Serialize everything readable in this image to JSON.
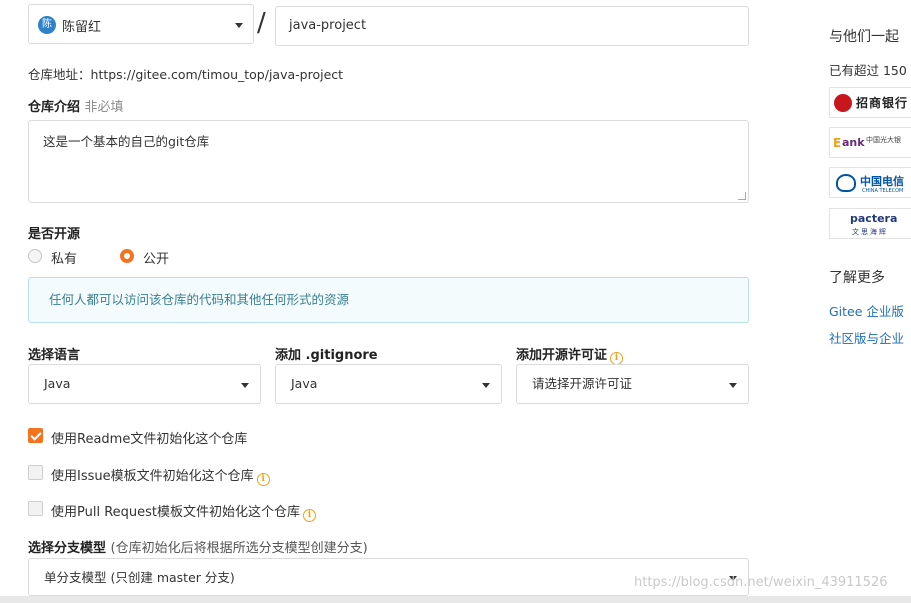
{
  "owner": {
    "avatar_text": "陈",
    "name": "陈留红"
  },
  "path_separator": "/",
  "repo_path": {
    "value": "java-project"
  },
  "repo_url": {
    "label": "仓库地址：",
    "url": "https://gitee.com/timou_top/java-project"
  },
  "description": {
    "label": "仓库介绍",
    "hint": "非必填",
    "value": "这是一个基本的自己的git仓库"
  },
  "visibility": {
    "label": "是否开源",
    "options": [
      {
        "label": "私有",
        "selected": false
      },
      {
        "label": "公开",
        "selected": true
      }
    ],
    "notice": "任何人都可以访问该仓库的代码和其他任何形式的资源"
  },
  "language": {
    "label": "选择语言",
    "value": "Java"
  },
  "gitignore": {
    "label": "添加 .gitignore",
    "value": "Java"
  },
  "license": {
    "label": "添加开源许可证",
    "value": "请选择开源许可证"
  },
  "init_options": [
    {
      "label": "使用Readme文件初始化这个仓库",
      "checked": true,
      "info": false
    },
    {
      "label": "使用Issue模板文件初始化这个仓库",
      "checked": false,
      "info": true
    },
    {
      "label": "使用Pull Request模板文件初始化这个仓库",
      "checked": false,
      "info": true
    }
  ],
  "branch_model": {
    "label": "选择分支模型",
    "hint": "(仓库初始化后将根据所选分支模型创建分支)",
    "value": "单分支模型 (只创建 master 分支)"
  },
  "sidebar": {
    "title": "与他们一起",
    "subtitle": "已有超过 150",
    "logos": [
      {
        "name": "cmb-logo",
        "text": "招商银行"
      },
      {
        "name": "ceb-logo",
        "text_e": "E",
        "text_ank": "ank",
        "text_cn": "中国光大银"
      },
      {
        "name": "china-telecom-logo",
        "text": "中国电信",
        "text_en": "CHINA TELECOM"
      },
      {
        "name": "pactera-logo",
        "text": "pactera",
        "text_cn": "文思海辉"
      }
    ],
    "more_heading": "了解更多",
    "links": [
      "Gitee 企业版",
      "社区版与企业"
    ]
  },
  "watermark": "https://blog.csdn.net/weixin_43911526",
  "colors": {
    "accent": "#f4731f",
    "link": "#1f6fb5",
    "notice_bg": "#f3fbfd",
    "notice_text": "#3a7f93",
    "info": "#f0a020"
  }
}
